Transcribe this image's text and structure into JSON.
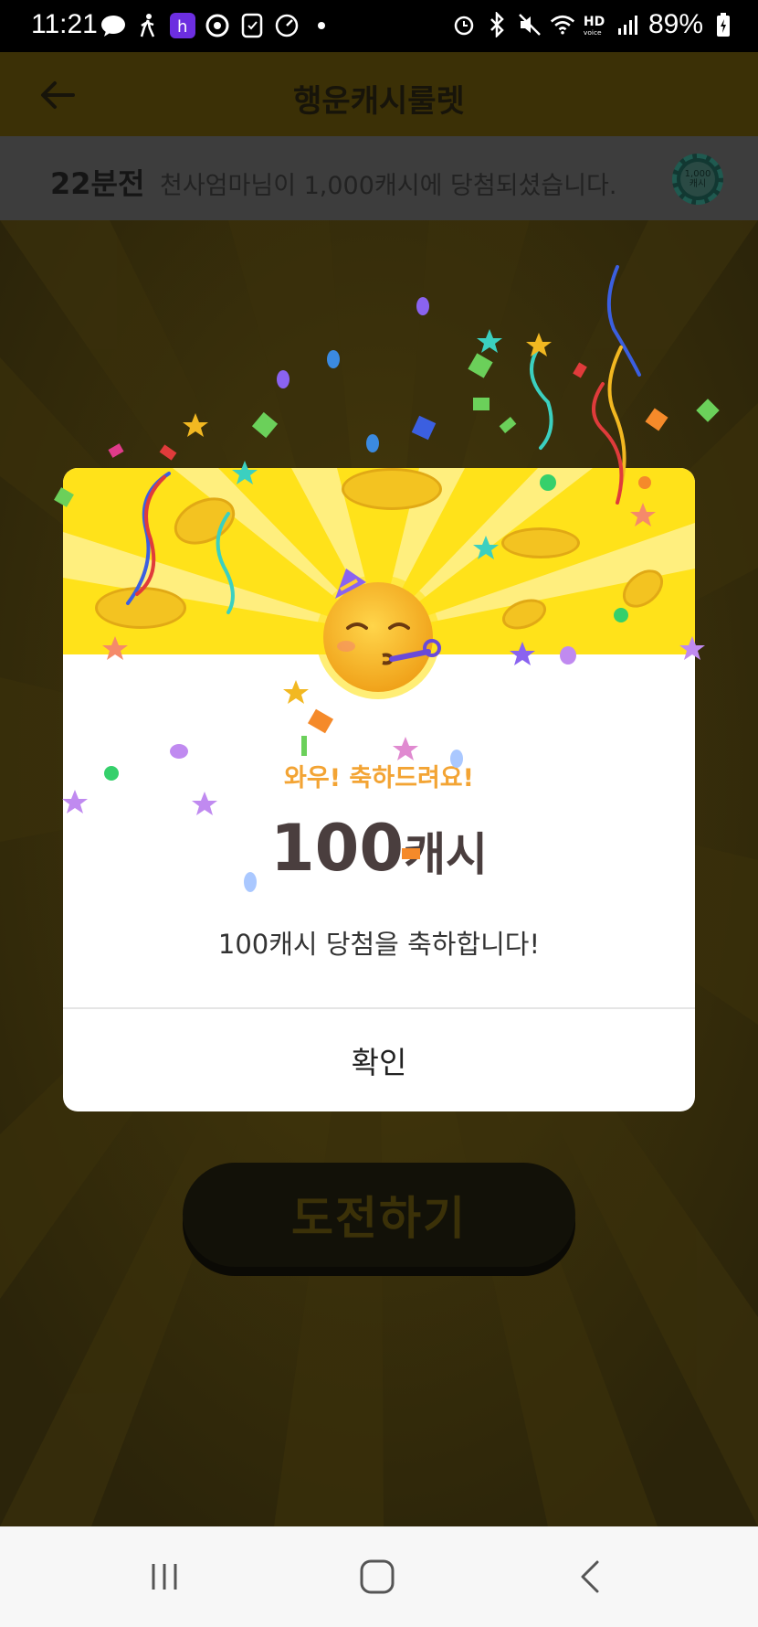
{
  "status_bar": {
    "time": "11:21",
    "battery_percent": "89%",
    "network_label": "HD",
    "icons_left": [
      "chat-bubble-icon",
      "walking-icon",
      "h-app-icon",
      "app-ring-icon",
      "clipboard-icon",
      "gauge-icon",
      "dot-icon"
    ],
    "icons_right": [
      "alarm-icon",
      "bluetooth-icon",
      "mute-icon",
      "wifi-icon",
      "hd-voice-icon",
      "signal-icon",
      "battery-icon"
    ]
  },
  "header": {
    "title": "행운캐시룰렛",
    "back_icon": "arrow-left-icon"
  },
  "ticker": {
    "time_ago": "22분전",
    "message": "천사엄마님이 1,000캐시에 당첨되셨습니다.",
    "chip_label": "1,000 캐시"
  },
  "main": {
    "challenge_label": "도전하기"
  },
  "modal": {
    "emoji": "party-face-emoji",
    "congrats": "와우! 축하드려요!",
    "amount_number": "100",
    "amount_unit": "캐시",
    "description": "100캐시 당첨을 축하합니다!",
    "confirm_label": "확인"
  },
  "navbar": {
    "items": [
      "recent-apps-icon",
      "home-icon",
      "back-icon"
    ]
  },
  "colors": {
    "modal_header": "#ffe21a",
    "congrats_text": "#f3a434",
    "amount_text": "#4a3e3e",
    "dim_backdrop": "#2c250a"
  }
}
